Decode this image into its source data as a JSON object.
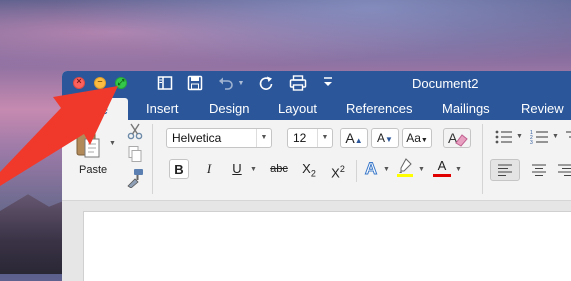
{
  "window": {
    "document_title": "Document2"
  },
  "quick_access": {
    "icons": [
      "sidebar-icon",
      "save-icon",
      "undo-icon",
      "redo-icon",
      "print-icon",
      "customize-icon"
    ]
  },
  "tabs": [
    {
      "label": "Home",
      "visible_text": "me"
    },
    {
      "label": "Insert"
    },
    {
      "label": "Design"
    },
    {
      "label": "Layout"
    },
    {
      "label": "References"
    },
    {
      "label": "Mailings"
    },
    {
      "label": "Review"
    }
  ],
  "clipboard": {
    "paste_label": "Paste"
  },
  "font": {
    "family": "Helvetica",
    "size": "12",
    "grow_label": "A",
    "shrink_label": "A",
    "change_case_label": "Aa",
    "bold": "B",
    "italic": "I",
    "underline": "U",
    "strikethrough": "abc",
    "subscript_base": "X",
    "subscript_index": "2",
    "superscript_base": "X",
    "superscript_index": "2",
    "effects_label": "A",
    "font_color_label": "A"
  },
  "colors": {
    "brand": "#2b579a",
    "highlight": "#ffff00",
    "font_color": "#e00000",
    "annotation_arrow": "#f0392b"
  }
}
